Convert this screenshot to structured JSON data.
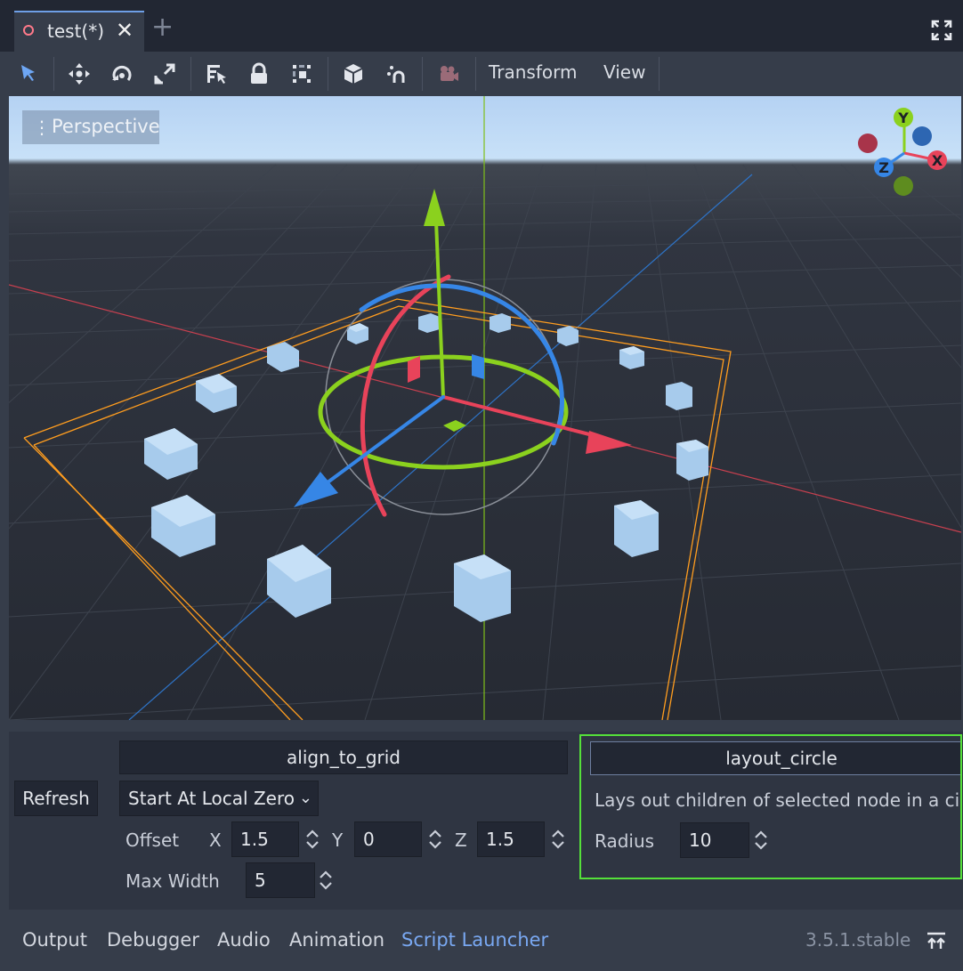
{
  "tabs": {
    "active_label": "test(*)",
    "close_icon": "close-icon",
    "add_icon": "plus-icon"
  },
  "toolbar": {
    "tools": [
      "select-icon",
      "move-icon",
      "rotate-icon",
      "scale-icon",
      "list-select-icon",
      "lock-icon",
      "group-icon",
      "local-space-icon",
      "snap-icon",
      "camera-icon"
    ],
    "transform_label": "Transform",
    "view_label": "View"
  },
  "viewport": {
    "perspective_label": "Perspective",
    "gizmo": {
      "y": "Y",
      "x": "X",
      "z": "Z"
    },
    "colors": {
      "x_axis": "#e8435a",
      "y_axis": "#8bd11e",
      "z_axis": "#3686e6",
      "bounds": "#ff9d1f",
      "cube": "#a7cbec"
    }
  },
  "panel": {
    "refresh_label": "Refresh",
    "align_label": "align_to_grid",
    "start_option": "Start At Local Zero",
    "offset_label": "Offset",
    "x_label": "X",
    "x_value": "1.5",
    "y_label": "Y",
    "y_value": "0",
    "z_label": "Z",
    "z_value": "1.5",
    "max_width_label": "Max Width",
    "max_width_value": "5",
    "layout_label": "layout_circle",
    "layout_desc": "Lays out children of selected node in a circle",
    "radius_label": "Radius",
    "radius_value": "10",
    "highlight_color": "#55e03a"
  },
  "bottom_tabs": [
    "Output",
    "Debugger",
    "Audio",
    "Animation",
    "Script Launcher"
  ],
  "active_bottom_tab": "Script Launcher",
  "version": "3.5.1.stable"
}
